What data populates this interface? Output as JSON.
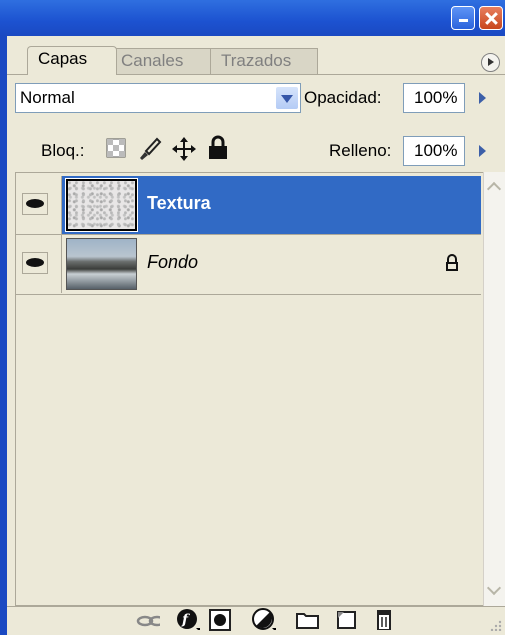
{
  "tabs": [
    {
      "label": "Capas",
      "active": true
    },
    {
      "label": "Canales",
      "active": false
    },
    {
      "label": "Trazados",
      "active": false
    }
  ],
  "blend": {
    "mode": "Normal"
  },
  "opacity": {
    "label": "Opacidad:",
    "value": "100%"
  },
  "lock": {
    "label": "Bloq.:"
  },
  "fill": {
    "label": "Relleno:",
    "value": "100%"
  },
  "layers": [
    {
      "name": "Textura",
      "selected": true,
      "visible": true,
      "locked": false
    },
    {
      "name": "Fondo",
      "selected": false,
      "visible": true,
      "locked": true
    }
  ],
  "colors": {
    "selection": "#316ac5",
    "panel": "#ece9d8",
    "titlebar": "#1c52d0"
  },
  "icons": {
    "lock_row": [
      "transparency-lock-icon",
      "brush-lock-icon",
      "move-lock-icon",
      "padlock-icon"
    ],
    "toolbar": [
      "link-layers-icon",
      "layer-style-icon",
      "layer-mask-icon",
      "adjustment-layer-icon",
      "new-group-icon",
      "new-layer-icon",
      "trash-icon"
    ]
  }
}
